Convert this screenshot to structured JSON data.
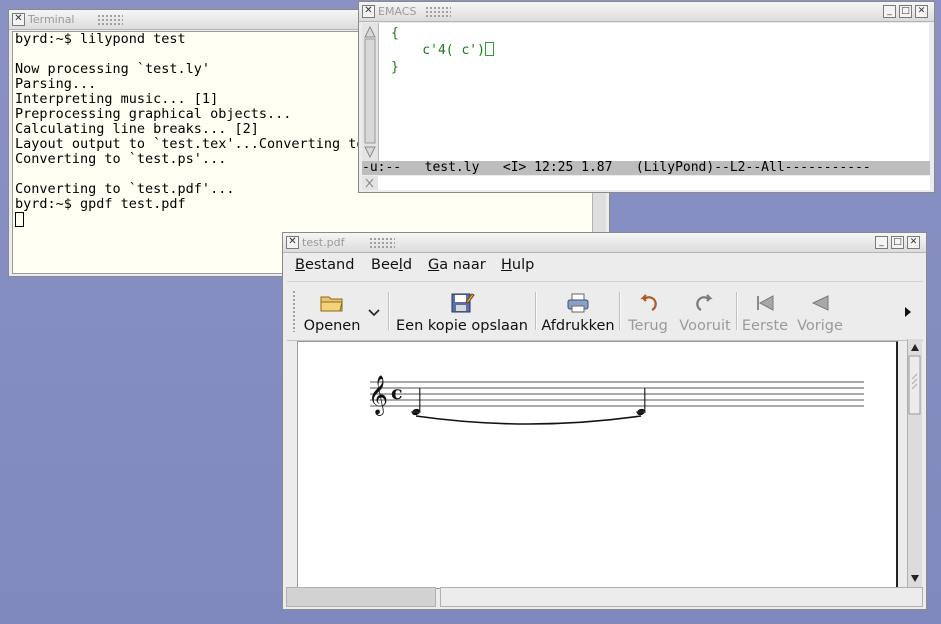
{
  "terminal": {
    "title": "Terminal",
    "lines": [
      "byrd:~$ lilypond test",
      "",
      "Now processing `test.ly'",
      "Parsing...",
      "Interpreting music... [1]",
      "Preprocessing graphical objects...",
      "Calculating line breaks... [2]",
      "Layout output to `test.tex'...Converting to `test.dvi'...",
      "Converting to `test.ps'...",
      "",
      "Converting to `test.pdf'...",
      "byrd:~$ gpdf test.pdf"
    ]
  },
  "emacs": {
    "title": "EMACS",
    "lines": [
      "{",
      "    c'4( c')",
      "}"
    ],
    "modeline": "-u:--   test.ly   <I> 12:25 1.87   (LilyPond)--L2--All-----------"
  },
  "pdf_viewer": {
    "title": "test.pdf",
    "menu": [
      {
        "pre": "",
        "mnemonic": "B",
        "post": "estand"
      },
      {
        "pre": "Bee",
        "mnemonic": "l",
        "post": "d"
      },
      {
        "pre": "",
        "mnemonic": "G",
        "post": "a naar"
      },
      {
        "pre": "",
        "mnemonic": "H",
        "post": "ulp"
      }
    ],
    "toolbar": {
      "open": "Openen",
      "save_copy": "Een kopie opslaan",
      "print": "Afdrukken",
      "back": "Terug",
      "forward": "Vooruit",
      "first": "Eerste",
      "previous": "Vorige"
    },
    "icons": [
      "folder-icon",
      "save-icon",
      "printer-icon",
      "back-arrow-icon",
      "forward-arrow-icon",
      "first-page-icon",
      "previous-page-icon",
      "chevron-down-icon",
      "overflow-arrow-icon"
    ],
    "score": {
      "clef": "treble",
      "time_signature": "c",
      "notes": [
        "c'4",
        "c'"
      ],
      "slur": true
    }
  },
  "colors": {
    "desktop": "#8089bd",
    "terminal_bg": "#fffff4",
    "emacs_text": "#1a7a1a",
    "modeline": "#bdbdbd"
  }
}
